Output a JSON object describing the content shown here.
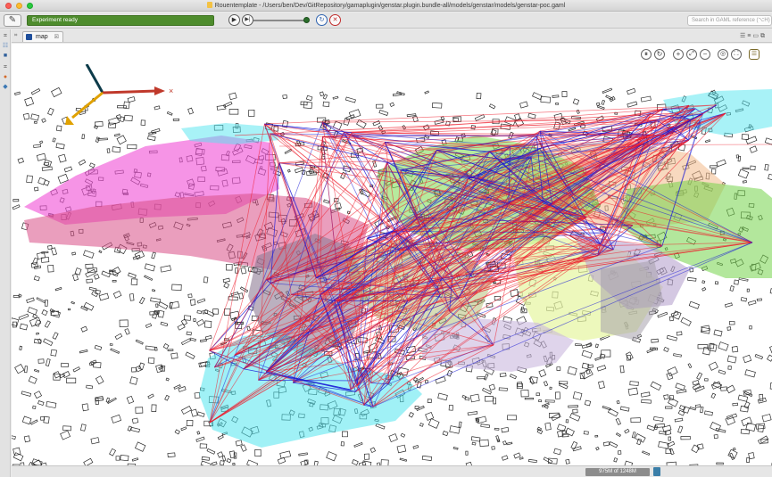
{
  "window": {
    "title": "Rouentemplate - /Users/ben/Dev/GitRepository/gamaplugin/genstar.plugin.bundle-all/models/genstar/models/genstar-poc.gaml"
  },
  "toolbar": {
    "experiment_status": "Experiment ready",
    "play_label": "▶",
    "step_label": "▶|",
    "reload_label": "↻",
    "close_label": "✕",
    "search_placeholder": "Search in GAML reference (⌥H)"
  },
  "view": {
    "tab_label": "map",
    "tab_close": "☒"
  },
  "map_toolbar": {
    "pause": "⏸",
    "sync": "↻",
    "zoom_in": "+",
    "zoom_fit": "⤢",
    "zoom_out": "−",
    "snapshot": "◎",
    "fullscreen": "⛶",
    "layers": "☰"
  },
  "status": {
    "memory": "975M of 1248M"
  },
  "colors": {
    "status_green": "#4e8c2d",
    "axis_x": "#c0392b",
    "axis_y": "#0d3b4a",
    "axis_z": "#e0a100",
    "network_blue": "#1a1ad6",
    "network_red": "#ee1d2b"
  }
}
